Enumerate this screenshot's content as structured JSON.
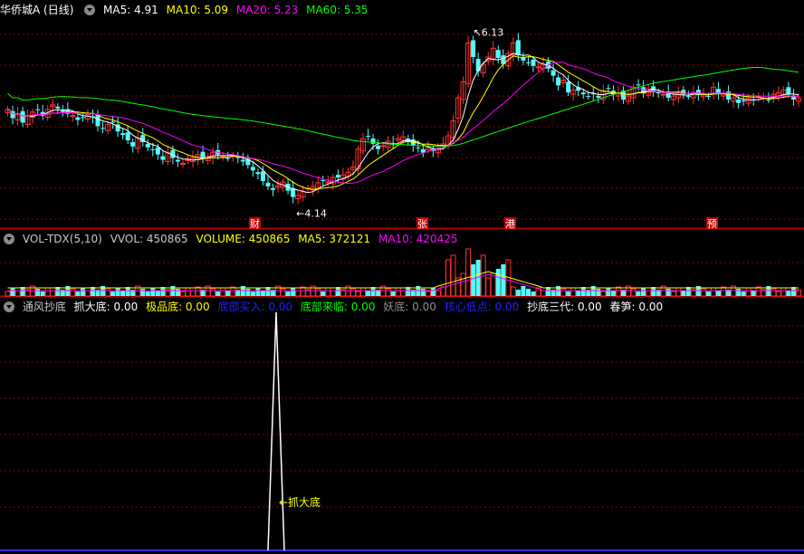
{
  "colors": {
    "up": "#ff3232",
    "down": "#54fcfc",
    "ma5": "#ffffff",
    "ma10": "#ffff00",
    "ma20": "#ff00ff",
    "ma60": "#00ff00",
    "grid": "#8b0000",
    "event": "#c80000"
  },
  "price_panel": {
    "title": "华侨城A (日线)",
    "legend": [
      {
        "label": "MA5: 4.91",
        "color": "#ffffff"
      },
      {
        "label": "MA10: 5.09",
        "color": "#ffff00"
      },
      {
        "label": "MA20: 5.23",
        "color": "#ff00ff"
      },
      {
        "label": "MA60: 5.35",
        "color": "#00ff00"
      }
    ],
    "high_label": "6.13",
    "low_label": "4.14",
    "event_marks": [
      "财",
      "张",
      "港",
      "预"
    ]
  },
  "volume_panel": {
    "title": "VOL-TDX(5,10)",
    "legend": [
      {
        "label": "VVOL: 450865",
        "color": "#c8c8c8"
      },
      {
        "label": "VOLUME: 450865",
        "color": "#ffff00"
      },
      {
        "label": "MA5: 372121",
        "color": "#ffff00"
      },
      {
        "label": "MA10: 420425",
        "color": "#ff00ff"
      }
    ]
  },
  "indicator_panel": {
    "title": "通风抄底",
    "legend": [
      {
        "label": "抓大底: 0.00",
        "color": "#ffffff"
      },
      {
        "label": "极品底: 0.00",
        "color": "#ffff00"
      },
      {
        "label": "底部买入: 0.00",
        "color": "#2020ff"
      },
      {
        "label": "底部来临: 0.00",
        "color": "#00ff00"
      },
      {
        "label": "妖底: 0.00",
        "color": "#909090"
      },
      {
        "label": "核心低点: 0.00",
        "color": "#2020ff"
      },
      {
        "label": "抄底三代: 0.00",
        "color": "#ffffff"
      },
      {
        "label": "春笋: 0.00",
        "color": "#ffffff"
      }
    ],
    "signal_label": "抓大底"
  },
  "chart_data": {
    "type": "candlestick",
    "ylim": [
      4.0,
      6.3
    ],
    "high": 6.13,
    "low": 4.14,
    "ma_latest": {
      "MA5": 4.91,
      "MA10": 5.09,
      "MA20": 5.23,
      "MA60": 5.35
    },
    "volume_latest": {
      "VVOL": 450865,
      "VOLUME": 450865,
      "MA5": 372121,
      "MA10": 420425
    },
    "indicator": {
      "抓大底": 0.0,
      "极品底": 0.0,
      "底部买入": 0.0,
      "底部来临": 0.0,
      "妖底": 0.0,
      "核心低点": 0.0,
      "抄底三代": 0.0,
      "春笋": 0.0
    },
    "close": [
      5.27,
      5.17,
      5.22,
      5.12,
      5.2,
      5.24,
      5.26,
      5.2,
      5.27,
      5.32,
      5.28,
      5.24,
      5.22,
      5.2,
      5.15,
      5.18,
      5.21,
      5.18,
      5.08,
      5.05,
      5.1,
      5.12,
      5.02,
      4.98,
      4.92,
      4.85,
      4.95,
      4.9,
      4.84,
      4.81,
      4.76,
      4.7,
      4.78,
      4.72,
      4.68,
      4.66,
      4.7,
      4.72,
      4.76,
      4.71,
      4.74,
      4.78,
      4.76,
      4.74,
      4.72,
      4.75,
      4.72,
      4.68,
      4.64,
      4.58,
      4.54,
      4.46,
      4.4,
      4.36,
      4.41,
      4.45,
      4.35,
      4.28,
      4.3,
      4.34,
      4.38,
      4.4,
      4.44,
      4.46,
      4.45,
      4.5,
      4.5,
      4.53,
      4.56,
      4.62,
      4.82,
      4.94,
      4.96,
      4.88,
      4.82,
      4.86,
      4.91,
      4.89,
      4.94,
      4.96,
      4.9,
      4.86,
      4.84,
      4.78,
      4.84,
      4.8,
      4.83,
      4.88,
      4.97,
      5.14,
      5.4,
      5.58,
      6.02,
      5.86,
      5.7,
      5.78,
      5.86,
      5.96,
      5.85,
      5.78,
      5.9,
      6.02,
      5.88,
      5.82,
      5.8,
      5.76,
      5.75,
      5.78,
      5.73,
      5.65,
      5.54,
      5.6,
      5.46,
      5.49,
      5.48,
      5.44,
      5.42,
      5.44,
      5.4,
      5.48,
      5.5,
      5.44,
      5.45,
      5.38,
      5.42,
      5.52,
      5.54,
      5.45,
      5.5,
      5.48,
      5.46,
      5.44,
      5.4,
      5.42,
      5.46,
      5.44,
      5.42,
      5.46,
      5.43,
      5.44,
      5.42,
      5.52,
      5.44,
      5.44,
      5.38,
      5.4,
      5.34,
      5.36,
      5.4,
      5.38,
      5.42,
      5.4,
      5.38,
      5.44,
      5.46,
      5.49,
      5.44,
      5.38,
      5.4
    ],
    "volume_bars": 45
  }
}
